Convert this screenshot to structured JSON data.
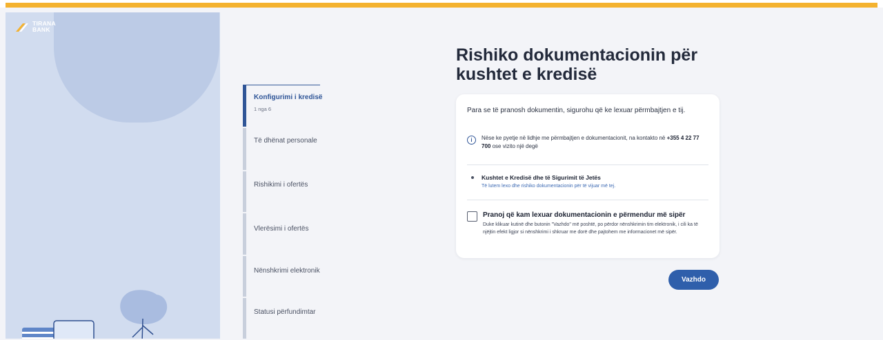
{
  "brand": {
    "name_line1": "TIRANA",
    "name_line2": "BANK",
    "accent": "#f4b22f",
    "primary": "#2f5597"
  },
  "stepper": {
    "steps": [
      {
        "label": "Konfigurimi i kredisë",
        "sub": "1 nga 6",
        "active": true
      },
      {
        "label": "Të dhënat personale"
      },
      {
        "label": "Rishikimi i ofertës"
      },
      {
        "label": "Vlerësimi i ofertës"
      },
      {
        "label": "Nënshkrimi elektronik"
      },
      {
        "label": "Statusi përfundimtar"
      }
    ]
  },
  "main": {
    "title": "Rishiko dokumentacionin për kushtet e kredisë",
    "intro": "Para se të pranosh dokumentin, sigurohu që ke lexuar përmbajtjen e tij.",
    "info": {
      "icon": "info-icon",
      "text_before": "Nëse ke pyetje në lidhje me përmbajtjen e dokumentacionit, na kontakto në ",
      "phone": "+355 4 22 77 700",
      "text_after": " ose vizito një degë"
    },
    "document": {
      "title": "Kushtet e Kredisë dhe të Sigurimit të Jetës",
      "link": "Të lutem lexo dhe rishiko dokumentacionin për të vijuar më tej."
    },
    "accept": {
      "checked": false,
      "title": "Pranoj që kam lexuar dokumentacionin e përmendur më sipër",
      "text": "Duke klikuar kutinë dhe butonin \"Vazhdo\" më poshtë, po përdor nënshkrimin tim elektronik, i cili ka të njëjtin efekt ligjor si nënshkrimi i shkruar me dorë dhe pajtohem me informacionet më sipër."
    },
    "continue_label": "Vazhdo"
  }
}
